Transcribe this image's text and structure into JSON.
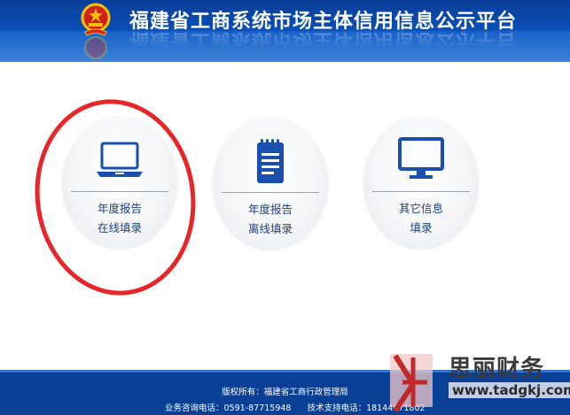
{
  "header": {
    "title": "福建省工商系统市场主体信用信息公示平台"
  },
  "cards": [
    {
      "line1": "年度报告",
      "line2": "在线填录",
      "icon": "laptop-icon"
    },
    {
      "line1": "年度报告",
      "line2": "离线填录",
      "icon": "notepad-icon"
    },
    {
      "line1": "其它信息",
      "line2": "填录",
      "icon": "monitor-icon"
    }
  ],
  "footer": {
    "copyright": "版权所有：福建省工商行政管理局",
    "contact": "业务咨询电话：0591-87715948      技术支持电话：18144071802"
  },
  "watermark": {
    "name": "思丽财务",
    "url": "www.tadgkj.com"
  },
  "colors": {
    "header_blue": "#0a4fb8",
    "accent_red": "#e8262a",
    "icon_blue": "#1a4fb0"
  }
}
